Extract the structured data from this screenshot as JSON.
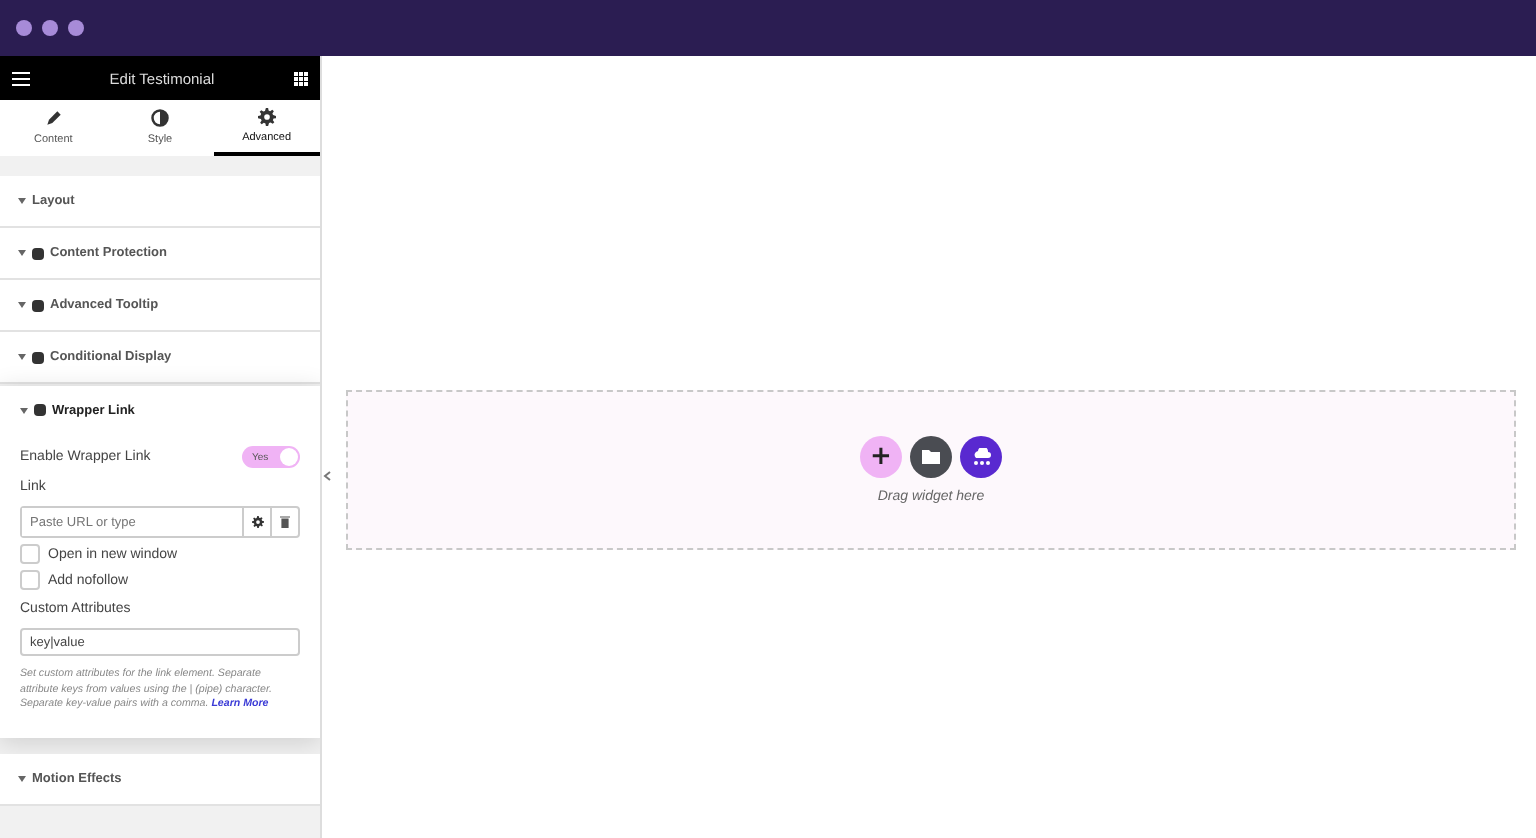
{
  "window": {
    "title": "Edit Testimonial"
  },
  "tabs": [
    {
      "label": "Content",
      "kind": "pencil",
      "selected": false
    },
    {
      "label": "Style",
      "kind": "contrast",
      "selected": false
    },
    {
      "label": "Advanced",
      "kind": "gear",
      "selected": true
    }
  ],
  "sections_before": [
    {
      "title": "Layout",
      "badge": false
    },
    {
      "title": "Content Protection",
      "badge": true
    },
    {
      "title": "Advanced Tooltip",
      "badge": true
    },
    {
      "title": "Conditional Display",
      "badge": true
    }
  ],
  "open_section": {
    "title": "Wrapper Link",
    "badge": true,
    "expanded": true,
    "toggle": {
      "label": "Enable Wrapper Link",
      "value": "Yes",
      "on": true
    },
    "link": {
      "label": "Link",
      "placeholder": "Paste URL or type"
    },
    "checkboxes": [
      {
        "label": "Open in new window",
        "checked": false
      },
      {
        "label": "Add nofollow",
        "checked": false
      }
    ],
    "custom_attributes": {
      "label": "Custom Attributes",
      "value": "key|value"
    },
    "help": "Set custom attributes for the link element. Separate attribute keys from values using the | (pipe) character. Separate key-value pairs with a comma.",
    "help_link": "Learn More"
  },
  "sections_after": [
    {
      "title": "Motion Effects",
      "badge": false
    }
  ],
  "canvas": {
    "drop_text": "Drag widget here",
    "buttons": [
      {
        "kind": "add",
        "icon": "+"
      },
      {
        "kind": "template"
      },
      {
        "kind": "kit"
      }
    ]
  }
}
